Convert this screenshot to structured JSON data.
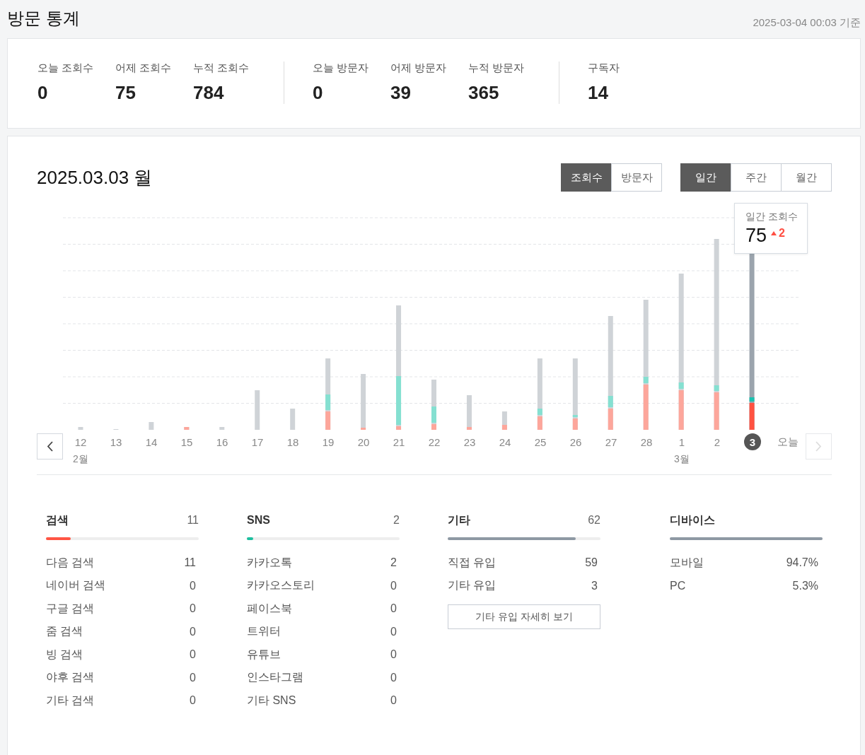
{
  "header": {
    "title": "방문 통계",
    "timestamp": "2025-03-04 00:03 기준"
  },
  "summary": {
    "groups": [
      [
        {
          "label": "오늘 조회수",
          "value": "0"
        },
        {
          "label": "어제 조회수",
          "value": "75"
        },
        {
          "label": "누적 조회수",
          "value": "784"
        }
      ],
      [
        {
          "label": "오늘 방문자",
          "value": "0"
        },
        {
          "label": "어제 방문자",
          "value": "39"
        },
        {
          "label": "누적 방문자",
          "value": "365"
        }
      ],
      [
        {
          "label": "구독자",
          "value": "14"
        }
      ]
    ]
  },
  "chart_panel": {
    "date_title": "2025.03.03 월",
    "metric_tabs": [
      {
        "label": "조회수",
        "selected": true
      },
      {
        "label": "방문자",
        "selected": false
      }
    ],
    "period_tabs": [
      {
        "label": "일간",
        "selected": true
      },
      {
        "label": "주간",
        "selected": false
      },
      {
        "label": "월간",
        "selected": false
      }
    ],
    "tooltip": {
      "label": "일간 조회수",
      "value": "75",
      "change": "2"
    },
    "pager": {
      "prev_disabled": false,
      "next_disabled": true
    },
    "days": [
      {
        "label": "12",
        "month": "2월",
        "selected": false
      },
      {
        "label": "13",
        "selected": false
      },
      {
        "label": "14",
        "selected": false
      },
      {
        "label": "15",
        "selected": false
      },
      {
        "label": "16",
        "selected": false
      },
      {
        "label": "17",
        "selected": false
      },
      {
        "label": "18",
        "selected": false
      },
      {
        "label": "19",
        "selected": false
      },
      {
        "label": "20",
        "selected": false
      },
      {
        "label": "21",
        "selected": false
      },
      {
        "label": "22",
        "selected": false
      },
      {
        "label": "23",
        "selected": false
      },
      {
        "label": "24",
        "selected": false
      },
      {
        "label": "25",
        "selected": false
      },
      {
        "label": "26",
        "selected": false
      },
      {
        "label": "27",
        "selected": false
      },
      {
        "label": "28",
        "selected": false
      },
      {
        "label": "1",
        "month": "3월",
        "selected": false
      },
      {
        "label": "2",
        "selected": false
      },
      {
        "label": "3",
        "selected": true
      },
      {
        "label": "오늘",
        "selected": false
      }
    ]
  },
  "sources": [
    {
      "kind": "list",
      "title": "검색",
      "total": "11",
      "color": "#ff5544",
      "level": 0.16,
      "rows": [
        {
          "label": "다음 검색",
          "value": "11"
        },
        {
          "label": "네이버 검색",
          "value": "0"
        },
        {
          "label": "구글 검색",
          "value": "0"
        },
        {
          "label": "줌 검색",
          "value": "0"
        },
        {
          "label": "빙 검색",
          "value": "0"
        },
        {
          "label": "야후 검색",
          "value": "0"
        },
        {
          "label": "기타 검색",
          "value": "0"
        }
      ]
    },
    {
      "kind": "list",
      "title": "SNS",
      "total": "2",
      "color": "#1dbf9f",
      "level": 0.04,
      "rows": [
        {
          "label": "카카오톡",
          "value": "2"
        },
        {
          "label": "카카오스토리",
          "value": "0"
        },
        {
          "label": "페이스북",
          "value": "0"
        },
        {
          "label": "트위터",
          "value": "0"
        },
        {
          "label": "유튜브",
          "value": "0"
        },
        {
          "label": "인스타그램",
          "value": "0"
        },
        {
          "label": "기타 SNS",
          "value": "0"
        }
      ]
    },
    {
      "kind": "list",
      "title": "기타",
      "total": "62",
      "color": "#8e99a3",
      "level": 0.84,
      "rows": [
        {
          "label": "직접 유입",
          "value": "59"
        },
        {
          "label": "기타 유입",
          "value": "3"
        }
      ],
      "button": "기타 유입 자세히 보기"
    },
    {
      "kind": "device",
      "title": "디바이스",
      "color": "#8e99a3",
      "level": 1,
      "rows": [
        {
          "label": "모바일",
          "value": "94.7%"
        },
        {
          "label": "PC",
          "value": "5.3%"
        }
      ]
    }
  ]
}
